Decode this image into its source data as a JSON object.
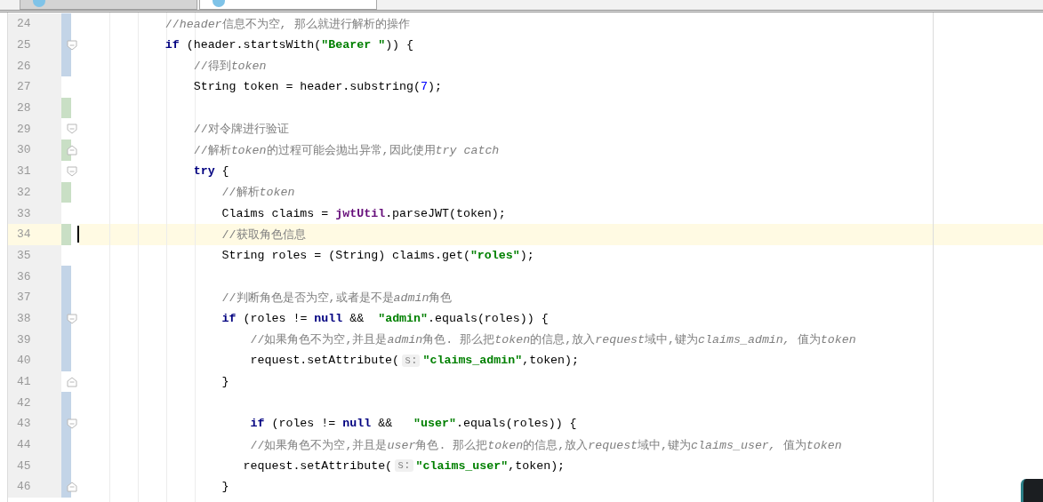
{
  "tabs": [
    {
      "selected": false
    },
    {
      "selected": true
    }
  ],
  "lines": [
    {
      "number": "24",
      "color": "#c3d4e7",
      "fold_open": false,
      "fold_close": false,
      "current": false,
      "tokens": [
        {
          "kind": "comment",
          "text": "            //"
        },
        {
          "kind": "comment_italic",
          "text": "header"
        },
        {
          "kind": "comment",
          "text": "信息不为空, 那么就进行解析的操作"
        }
      ]
    },
    {
      "number": "25",
      "color": "#c3d4e7",
      "fold_open": true,
      "fold_close": false,
      "current": false,
      "tokens": [
        {
          "kind": "keyword",
          "text": "            if"
        },
        {
          "kind": "plain",
          "text": " (header.startsWith("
        },
        {
          "kind": "string",
          "text": "\"Bearer \""
        },
        {
          "kind": "plain",
          "text": ")) {"
        }
      ]
    },
    {
      "number": "26",
      "color": "#c3d4e7",
      "fold_open": false,
      "fold_close": false,
      "current": false,
      "tokens": [
        {
          "kind": "comment",
          "text": "                //得到"
        },
        {
          "kind": "comment_italic",
          "text": "token"
        }
      ]
    },
    {
      "number": "27",
      "fold_open": false,
      "fold_close": false,
      "current": false,
      "tokens": [
        {
          "kind": "plain",
          "text": "                String token = header.substring("
        },
        {
          "kind": "number",
          "text": "7"
        },
        {
          "kind": "plain",
          "text": ");"
        }
      ]
    },
    {
      "number": "28",
      "color": "#c9dfc5",
      "fold_open": false,
      "fold_close": false,
      "current": false
    },
    {
      "number": "29",
      "fold_open": true,
      "fold_close": false,
      "current": false,
      "tokens": [
        {
          "kind": "comment",
          "text": "                //对令牌进行验证"
        }
      ]
    },
    {
      "number": "30",
      "color": "#c9dfc5",
      "fold_open": false,
      "fold_close": true,
      "current": false,
      "tokens": [
        {
          "kind": "comment",
          "text": "                //解析"
        },
        {
          "kind": "comment_italic",
          "text": "token"
        },
        {
          "kind": "comment",
          "text": "的过程可能会抛出异常,因此使用"
        },
        {
          "kind": "comment_italic",
          "text": "try catch"
        }
      ]
    },
    {
      "number": "31",
      "fold_open": true,
      "fold_close": false,
      "current": false,
      "tokens": [
        {
          "kind": "keyword",
          "text": "                try"
        },
        {
          "kind": "plain",
          "text": " {"
        }
      ]
    },
    {
      "number": "32",
      "color": "#c9dfc5",
      "fold_open": false,
      "fold_close": false,
      "current": false,
      "tokens": [
        {
          "kind": "comment",
          "text": "                    //解析"
        },
        {
          "kind": "comment_italic",
          "text": "token"
        }
      ]
    },
    {
      "number": "33",
      "fold_open": false,
      "fold_close": false,
      "current": false,
      "tokens": [
        {
          "kind": "plain",
          "text": "                    Claims claims = "
        },
        {
          "kind": "field",
          "text": "jwtUtil"
        },
        {
          "kind": "plain",
          "text": ".parseJWT(token);"
        }
      ]
    },
    {
      "number": "34",
      "color": "#c9dfc5",
      "fold_open": false,
      "fold_close": false,
      "current": true,
      "tokens": [
        {
          "kind": "comment",
          "text": "                    //获取角色信息"
        }
      ]
    },
    {
      "number": "35",
      "fold_open": false,
      "fold_close": false,
      "current": false,
      "tokens": [
        {
          "kind": "plain",
          "text": "                    String roles = (String) claims.get("
        },
        {
          "kind": "string",
          "text": "\"roles\""
        },
        {
          "kind": "plain",
          "text": ");"
        }
      ]
    },
    {
      "number": "36",
      "color": "#c3d4e7",
      "fold_open": false,
      "fold_close": false,
      "current": false
    },
    {
      "number": "37",
      "color": "#c3d4e7",
      "fold_open": false,
      "fold_close": false,
      "current": false,
      "tokens": [
        {
          "kind": "comment",
          "text": "                    //判断角色是否为空,或者是不是"
        },
        {
          "kind": "comment_italic",
          "text": "admin"
        },
        {
          "kind": "comment",
          "text": "角色"
        }
      ]
    },
    {
      "number": "38",
      "color": "#c3d4e7",
      "fold_open": true,
      "fold_close": false,
      "current": false,
      "tokens": [
        {
          "kind": "keyword",
          "text": "                    if"
        },
        {
          "kind": "plain",
          "text": " (roles != "
        },
        {
          "kind": "keyword",
          "text": "null"
        },
        {
          "kind": "plain",
          "text": " &&  "
        },
        {
          "kind": "string",
          "text": "\"admin\""
        },
        {
          "kind": "plain",
          "text": ".equals(roles)) {"
        }
      ]
    },
    {
      "number": "39",
      "color": "#c3d4e7",
      "fold_open": false,
      "fold_close": false,
      "current": false,
      "tokens": [
        {
          "kind": "comment",
          "text": "                        //如果角色不为空,并且是"
        },
        {
          "kind": "comment_italic",
          "text": "admin"
        },
        {
          "kind": "comment",
          "text": "角色. 那么把"
        },
        {
          "kind": "comment_italic",
          "text": "token"
        },
        {
          "kind": "comment",
          "text": "的信息,放入"
        },
        {
          "kind": "comment_italic",
          "text": "request"
        },
        {
          "kind": "comment",
          "text": "域中,键为"
        },
        {
          "kind": "comment_italic",
          "text": "claims_admin,"
        },
        {
          "kind": "comment",
          "text": " 值为"
        },
        {
          "kind": "comment_italic",
          "text": "token"
        }
      ]
    },
    {
      "number": "40",
      "color": "#c3d4e7",
      "fold_open": false,
      "fold_close": false,
      "current": false,
      "tokens": [
        {
          "kind": "plain",
          "text": "                        request.setAttribute("
        },
        {
          "kind": "hint",
          "text": "s:"
        },
        {
          "kind": "string",
          "text": "\"claims_admin\""
        },
        {
          "kind": "plain",
          "text": ",token);"
        }
      ]
    },
    {
      "number": "41",
      "fold_open": false,
      "fold_close": true,
      "current": false,
      "tokens": [
        {
          "kind": "plain",
          "text": "                    }"
        }
      ]
    },
    {
      "number": "42",
      "color": "#c3d4e7",
      "fold_open": false,
      "fold_close": false,
      "current": false
    },
    {
      "number": "43",
      "color": "#c3d4e7",
      "fold_open": true,
      "fold_close": false,
      "current": false,
      "tokens": [
        {
          "kind": "keyword",
          "text": "                        if"
        },
        {
          "kind": "plain",
          "text": " (roles != "
        },
        {
          "kind": "keyword",
          "text": "null"
        },
        {
          "kind": "plain",
          "text": " &&   "
        },
        {
          "kind": "string",
          "text": "\"user\""
        },
        {
          "kind": "plain",
          "text": ".equals(roles)) {"
        }
      ]
    },
    {
      "number": "44",
      "color": "#c3d4e7",
      "fold_open": false,
      "fold_close": false,
      "current": false,
      "tokens": [
        {
          "kind": "comment",
          "text": "                        //如果角色不为空,并且是"
        },
        {
          "kind": "comment_italic",
          "text": "user"
        },
        {
          "kind": "comment",
          "text": "角色. 那么把"
        },
        {
          "kind": "comment_italic",
          "text": "token"
        },
        {
          "kind": "comment",
          "text": "的信息,放入"
        },
        {
          "kind": "comment_italic",
          "text": "request"
        },
        {
          "kind": "comment",
          "text": "域中,键为"
        },
        {
          "kind": "comment_italic",
          "text": "claims_user,"
        },
        {
          "kind": "comment",
          "text": " 值为"
        },
        {
          "kind": "comment_italic",
          "text": "token"
        }
      ]
    },
    {
      "number": "45",
      "color": "#c3d4e7",
      "fold_open": false,
      "fold_close": false,
      "current": false,
      "tokens": [
        {
          "kind": "plain",
          "text": "                       request.setAttribute("
        },
        {
          "kind": "hint",
          "text": "s:"
        },
        {
          "kind": "string",
          "text": "\"claims_user\""
        },
        {
          "kind": "plain",
          "text": ",token);"
        }
      ]
    },
    {
      "number": "46",
      "color": "#c3d4e7",
      "fold_open": false,
      "fold_close": true,
      "current": false,
      "tokens": [
        {
          "kind": "plain",
          "text": "                    }"
        }
      ]
    }
  ]
}
